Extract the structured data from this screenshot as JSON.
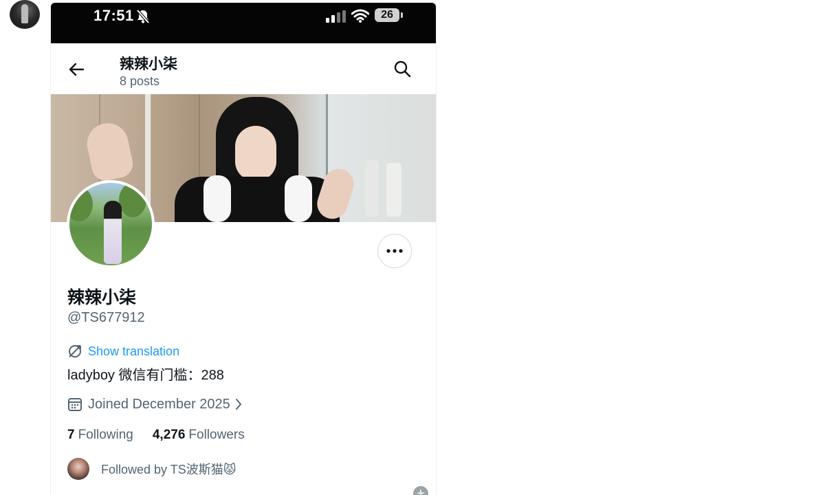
{
  "status_bar": {
    "time": "17:51",
    "battery": "26"
  },
  "header": {
    "name": "辣辣小柒",
    "post_count": "8 posts"
  },
  "profile": {
    "display_name": "辣辣小柒",
    "handle": "@TS677912",
    "translate_label": "Show translation",
    "bio": "ladyboy 微信有门槛：288",
    "joined": "Joined December 2025",
    "following_count": "7",
    "following_label": "Following",
    "followers_count": "4,276",
    "followers_label": "Followers",
    "followed_by": "Followed by TS波斯猫😾"
  },
  "icons": {
    "back": "arrow-left-icon",
    "search": "search-icon",
    "more": "more-horizontal-icon",
    "translate": "translate-icon",
    "calendar": "calendar-icon",
    "chevron": "chevron-right-icon",
    "bell_off": "bell-off-icon",
    "wifi": "wifi-icon",
    "signal": "signal-icon"
  },
  "colors": {
    "link": "#1d9bf0",
    "secondary_text": "#536471",
    "primary_text": "#0f1419",
    "status_bar": "#050505"
  }
}
